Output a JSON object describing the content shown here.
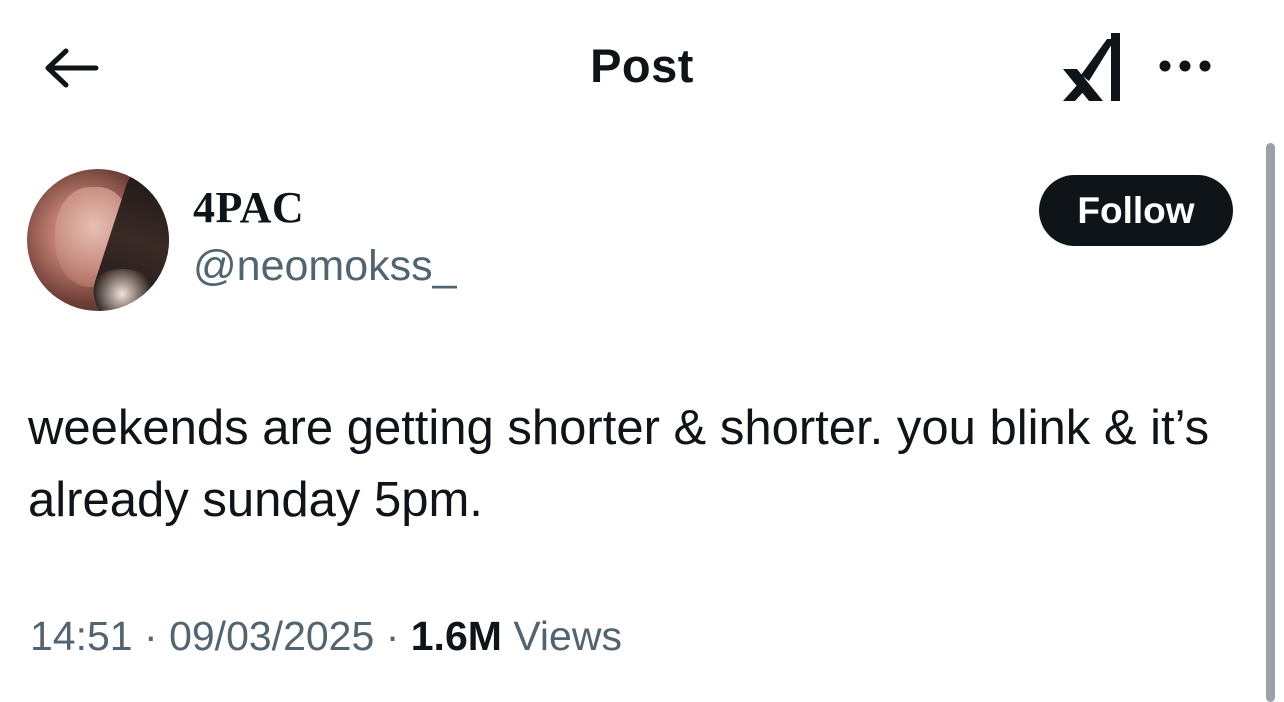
{
  "header": {
    "title": "Post",
    "back_icon": "arrow-left-icon",
    "grok_icon": "grok-icon",
    "more_icon": "more-horizontal-icon"
  },
  "author": {
    "display_name": "4PAC",
    "handle": "@neomokss_",
    "avatar_icon": "profile-photo"
  },
  "follow_button": {
    "label": "Follow"
  },
  "post": {
    "text": "weekends are getting shorter & shorter. you blink & it’s already sunday 5pm."
  },
  "meta": {
    "time": "14:51",
    "separator": "·",
    "date": "09/03/2025",
    "views_count": "1.6M",
    "views_label": "Views"
  },
  "colors": {
    "primary_text": "#0f1419",
    "secondary_text": "#536471",
    "follow_bg": "#0f1419",
    "follow_text": "#ffffff",
    "background": "#ffffff"
  }
}
